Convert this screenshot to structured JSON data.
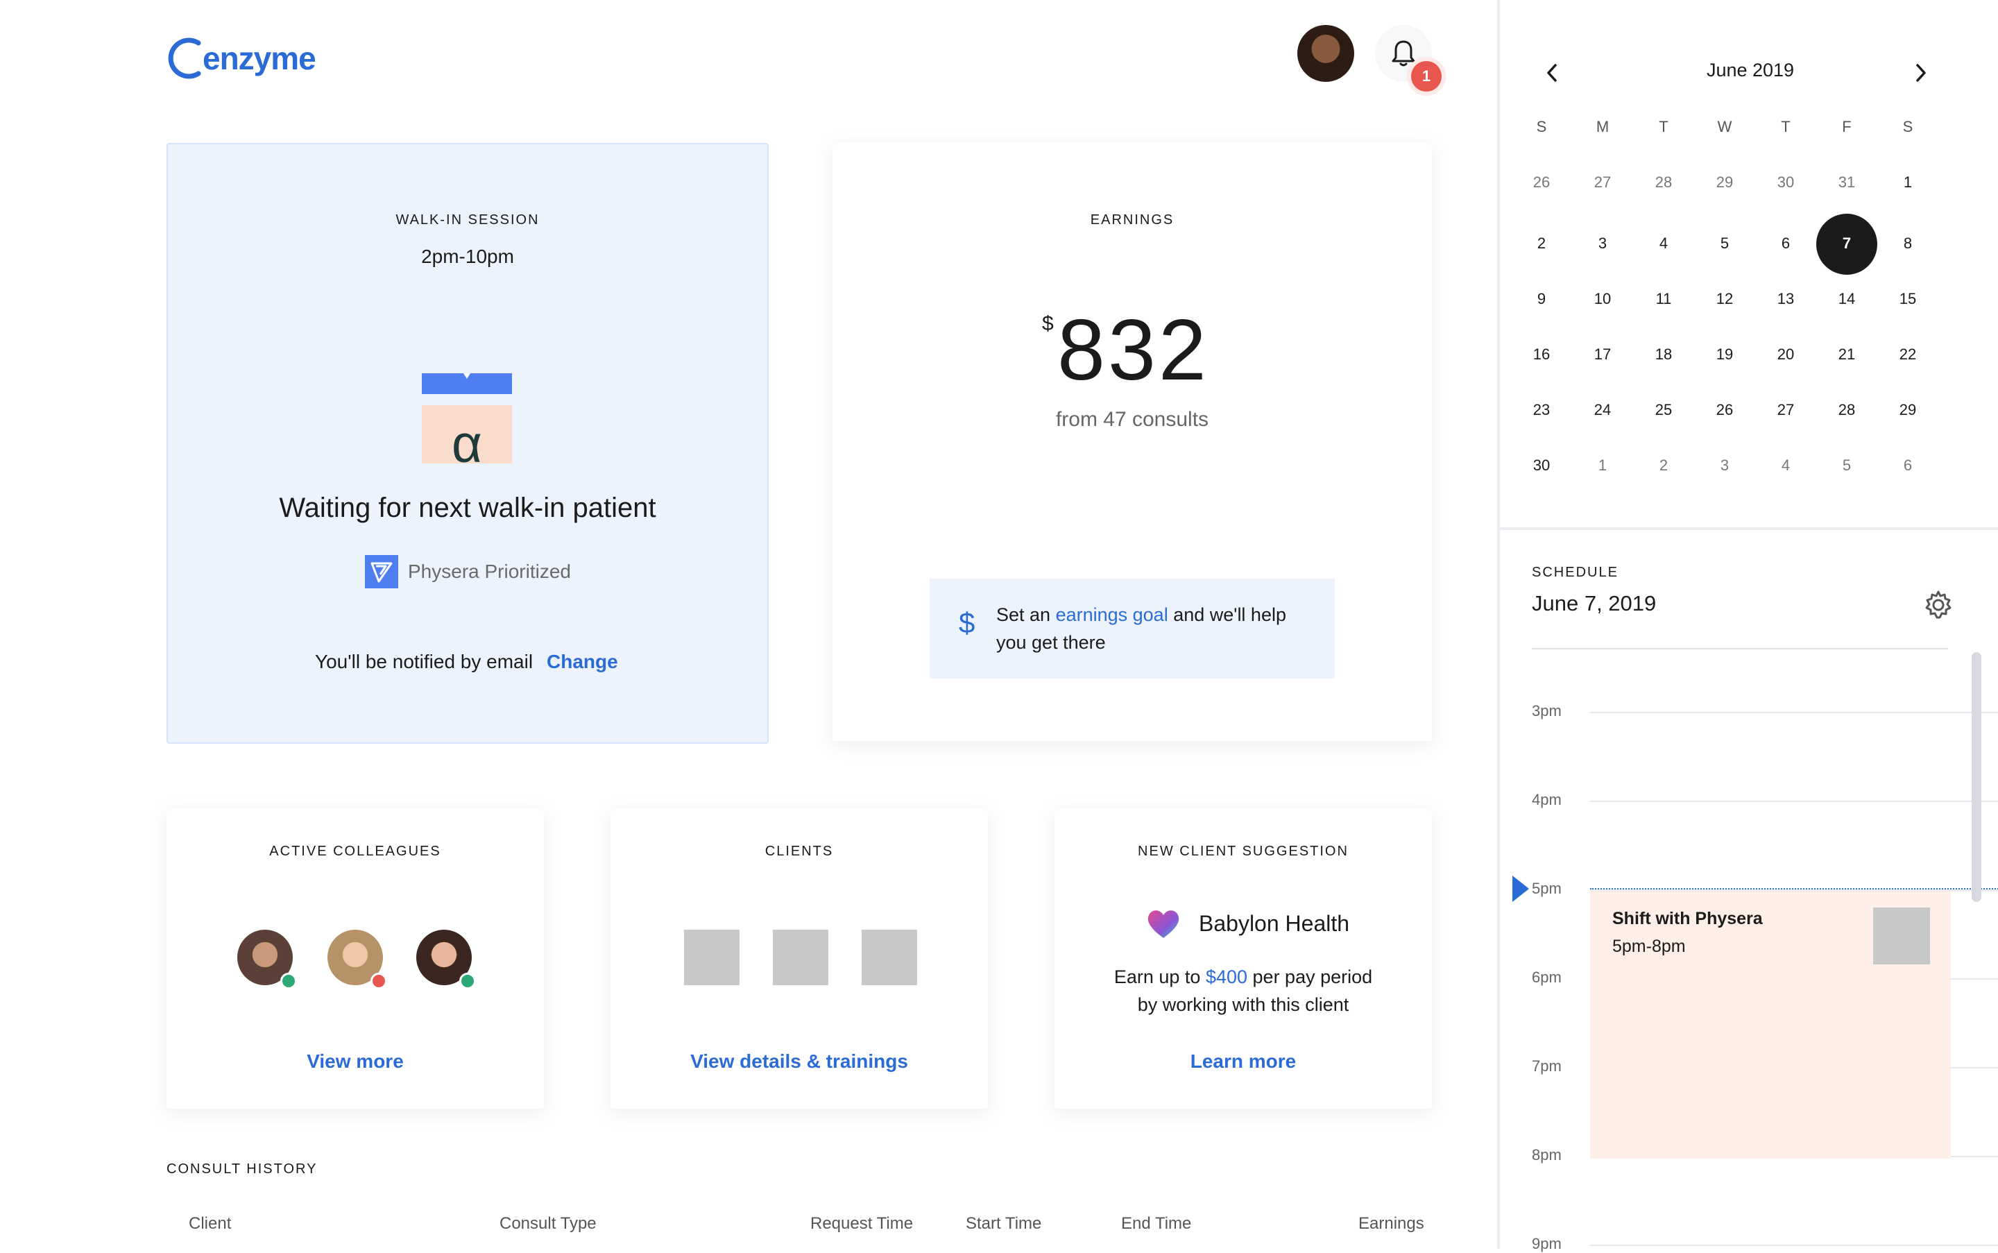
{
  "app": {
    "logo": "enzyme",
    "notification_count": "1"
  },
  "walk_in": {
    "kicker": "WALK-IN SESSION",
    "time": "2pm-10pm",
    "status": "Waiting for next walk-in patient",
    "partner": "Physera Prioritized",
    "notify_text": "You'll be notified by email",
    "change_label": "Change"
  },
  "earnings": {
    "kicker": "EARNINGS",
    "currency": "$",
    "amount": "832",
    "subtitle": "from 47 consults",
    "goal_prefix": "Set an",
    "goal_link": "earnings goal",
    "goal_suffix_line1": "and we'll help",
    "goal_suffix_line2": "you get there"
  },
  "colleagues": {
    "kicker": "ACTIVE COLLEAGUES",
    "action": "View more"
  },
  "clients": {
    "kicker": "CLIENTS",
    "action": "View details & trainings"
  },
  "suggestion": {
    "kicker": "NEW CLIENT SUGGESTION",
    "name": "Babylon Health",
    "line1_prefix": "Earn up to",
    "amount": "$400",
    "line1_suffix": "per pay period",
    "line2": "by working with this client",
    "action": "Learn more"
  },
  "consult_history": {
    "kicker": "CONSULT HISTORY",
    "columns": [
      "Client",
      "Consult Type",
      "Request Time",
      "Start Time",
      "End Time",
      "Earnings"
    ]
  },
  "calendar": {
    "month": "June 2019",
    "dow": [
      "S",
      "M",
      "T",
      "W",
      "T",
      "F",
      "S"
    ],
    "weeks": [
      [
        "26",
        "27",
        "28",
        "29",
        "30",
        "31",
        "1"
      ],
      [
        "2",
        "3",
        "4",
        "5",
        "6",
        "7",
        "8"
      ],
      [
        "9",
        "10",
        "11",
        "12",
        "13",
        "14",
        "15"
      ],
      [
        "16",
        "17",
        "18",
        "19",
        "20",
        "21",
        "22"
      ],
      [
        "23",
        "24",
        "25",
        "26",
        "27",
        "28",
        "29"
      ],
      [
        "30",
        "1",
        "2",
        "3",
        "4",
        "5",
        "6"
      ]
    ],
    "selected_day": "7"
  },
  "schedule": {
    "kicker": "SCHEDULE",
    "date": "June 7, 2019",
    "hours": [
      "3pm",
      "4pm",
      "5pm",
      "6pm",
      "7pm",
      "8pm",
      "9pm"
    ],
    "event_title": "Shift with Physera",
    "event_time": "5pm-8pm"
  },
  "colors": {
    "accent": "#2b6bd6",
    "badge": "#e8574f",
    "event": "#fdeee8",
    "walk_in_bg": "#edf3fd"
  }
}
